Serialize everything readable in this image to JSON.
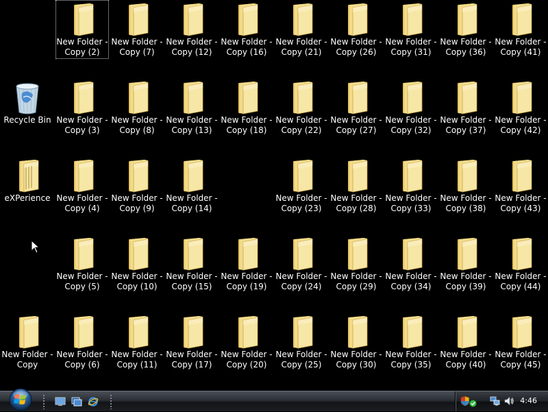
{
  "desktop": {
    "icons": [
      {
        "type": "folder",
        "label": "New Folder - Copy (2)",
        "selected": true
      },
      {
        "type": "folder",
        "label": "New Folder - Copy (7)"
      },
      {
        "type": "folder",
        "label": "New Folder - Copy (12)"
      },
      {
        "type": "folder",
        "label": "New Folder - Copy (16)"
      },
      {
        "type": "folder",
        "label": "New Folder - Copy (21)"
      },
      {
        "type": "folder",
        "label": "New Folder - Copy (26)"
      },
      {
        "type": "folder",
        "label": "New Folder - Copy (31)"
      },
      {
        "type": "folder",
        "label": "New Folder - Copy (36)"
      },
      {
        "type": "folder",
        "label": "New Folder - Copy (41)"
      },
      {
        "type": "recycle-bin",
        "label": "Recycle Bin"
      },
      {
        "type": "folder",
        "label": "New Folder - Copy (3)"
      },
      {
        "type": "folder",
        "label": "New Folder - Copy (8)"
      },
      {
        "type": "folder",
        "label": "New Folder - Copy (13)"
      },
      {
        "type": "folder",
        "label": "New Folder - Copy (18)"
      },
      {
        "type": "folder",
        "label": "New Folder - Copy (22)"
      },
      {
        "type": "folder",
        "label": "New Folder - Copy (27)"
      },
      {
        "type": "folder",
        "label": "New Folder - Copy (32)"
      },
      {
        "type": "folder",
        "label": "New Folder - Copy (37)"
      },
      {
        "type": "folder",
        "label": "New Folder - Copy (42)"
      },
      {
        "type": "folder-special",
        "label": "eXPerience"
      },
      {
        "type": "folder",
        "label": "New Folder - Copy (4)"
      },
      {
        "type": "folder",
        "label": "New Folder - Copy (9)"
      },
      {
        "type": "folder",
        "label": "New Folder - Copy (14)"
      },
      {
        "type": "folder",
        "label": "New Folder - Copy (23)"
      },
      {
        "type": "folder",
        "label": "New Folder - Copy (28)"
      },
      {
        "type": "folder",
        "label": "New Folder - Copy (33)"
      },
      {
        "type": "folder",
        "label": "New Folder - Copy (38)"
      },
      {
        "type": "folder",
        "label": "New Folder - Copy (43)"
      },
      {
        "type": "folder",
        "label": "New Folder - Copy (5)"
      },
      {
        "type": "folder",
        "label": "New Folder - Copy (10)"
      },
      {
        "type": "folder",
        "label": "New Folder - Copy (15)"
      },
      {
        "type": "folder",
        "label": "New Folder - Copy (19)"
      },
      {
        "type": "folder",
        "label": "New Folder - Copy (24)"
      },
      {
        "type": "folder",
        "label": "New Folder - Copy (29)"
      },
      {
        "type": "folder",
        "label": "New Folder - Copy (34)"
      },
      {
        "type": "folder",
        "label": "New Folder - Copy (39)"
      },
      {
        "type": "folder",
        "label": "New Folder - Copy (44)"
      },
      {
        "type": "folder",
        "label": "New Folder - Copy"
      },
      {
        "type": "folder",
        "label": "New Folder - Copy (6)"
      },
      {
        "type": "folder",
        "label": "New Folder - Copy (11)"
      },
      {
        "type": "folder",
        "label": "New Folder - Copy (17)"
      },
      {
        "type": "folder",
        "label": "New Folder - Copy (20)"
      },
      {
        "type": "folder",
        "label": "New Folder - Copy (25)"
      },
      {
        "type": "folder",
        "label": "New Folder - Copy (30)"
      },
      {
        "type": "folder",
        "label": "New Folder - Copy (35)"
      },
      {
        "type": "folder",
        "label": "New Folder - Copy (40)"
      },
      {
        "type": "folder",
        "label": "New Folder - Copy (45)"
      }
    ]
  },
  "taskbar": {
    "start_icon": "windows-logo-icon",
    "quick_launch": [
      {
        "name": "show-desktop-icon"
      },
      {
        "name": "switch-windows-icon"
      },
      {
        "name": "internet-explorer-icon"
      }
    ],
    "tray_icons": [
      {
        "name": "security-shield-icon"
      },
      {
        "name": "network-icon"
      },
      {
        "name": "volume-icon"
      }
    ],
    "clock": "4:46"
  },
  "colors": {
    "desktop_background": "#000000",
    "folder_light": "#f6e39a",
    "folder_dark": "#d9b24e",
    "label_text": "#ffffff"
  }
}
